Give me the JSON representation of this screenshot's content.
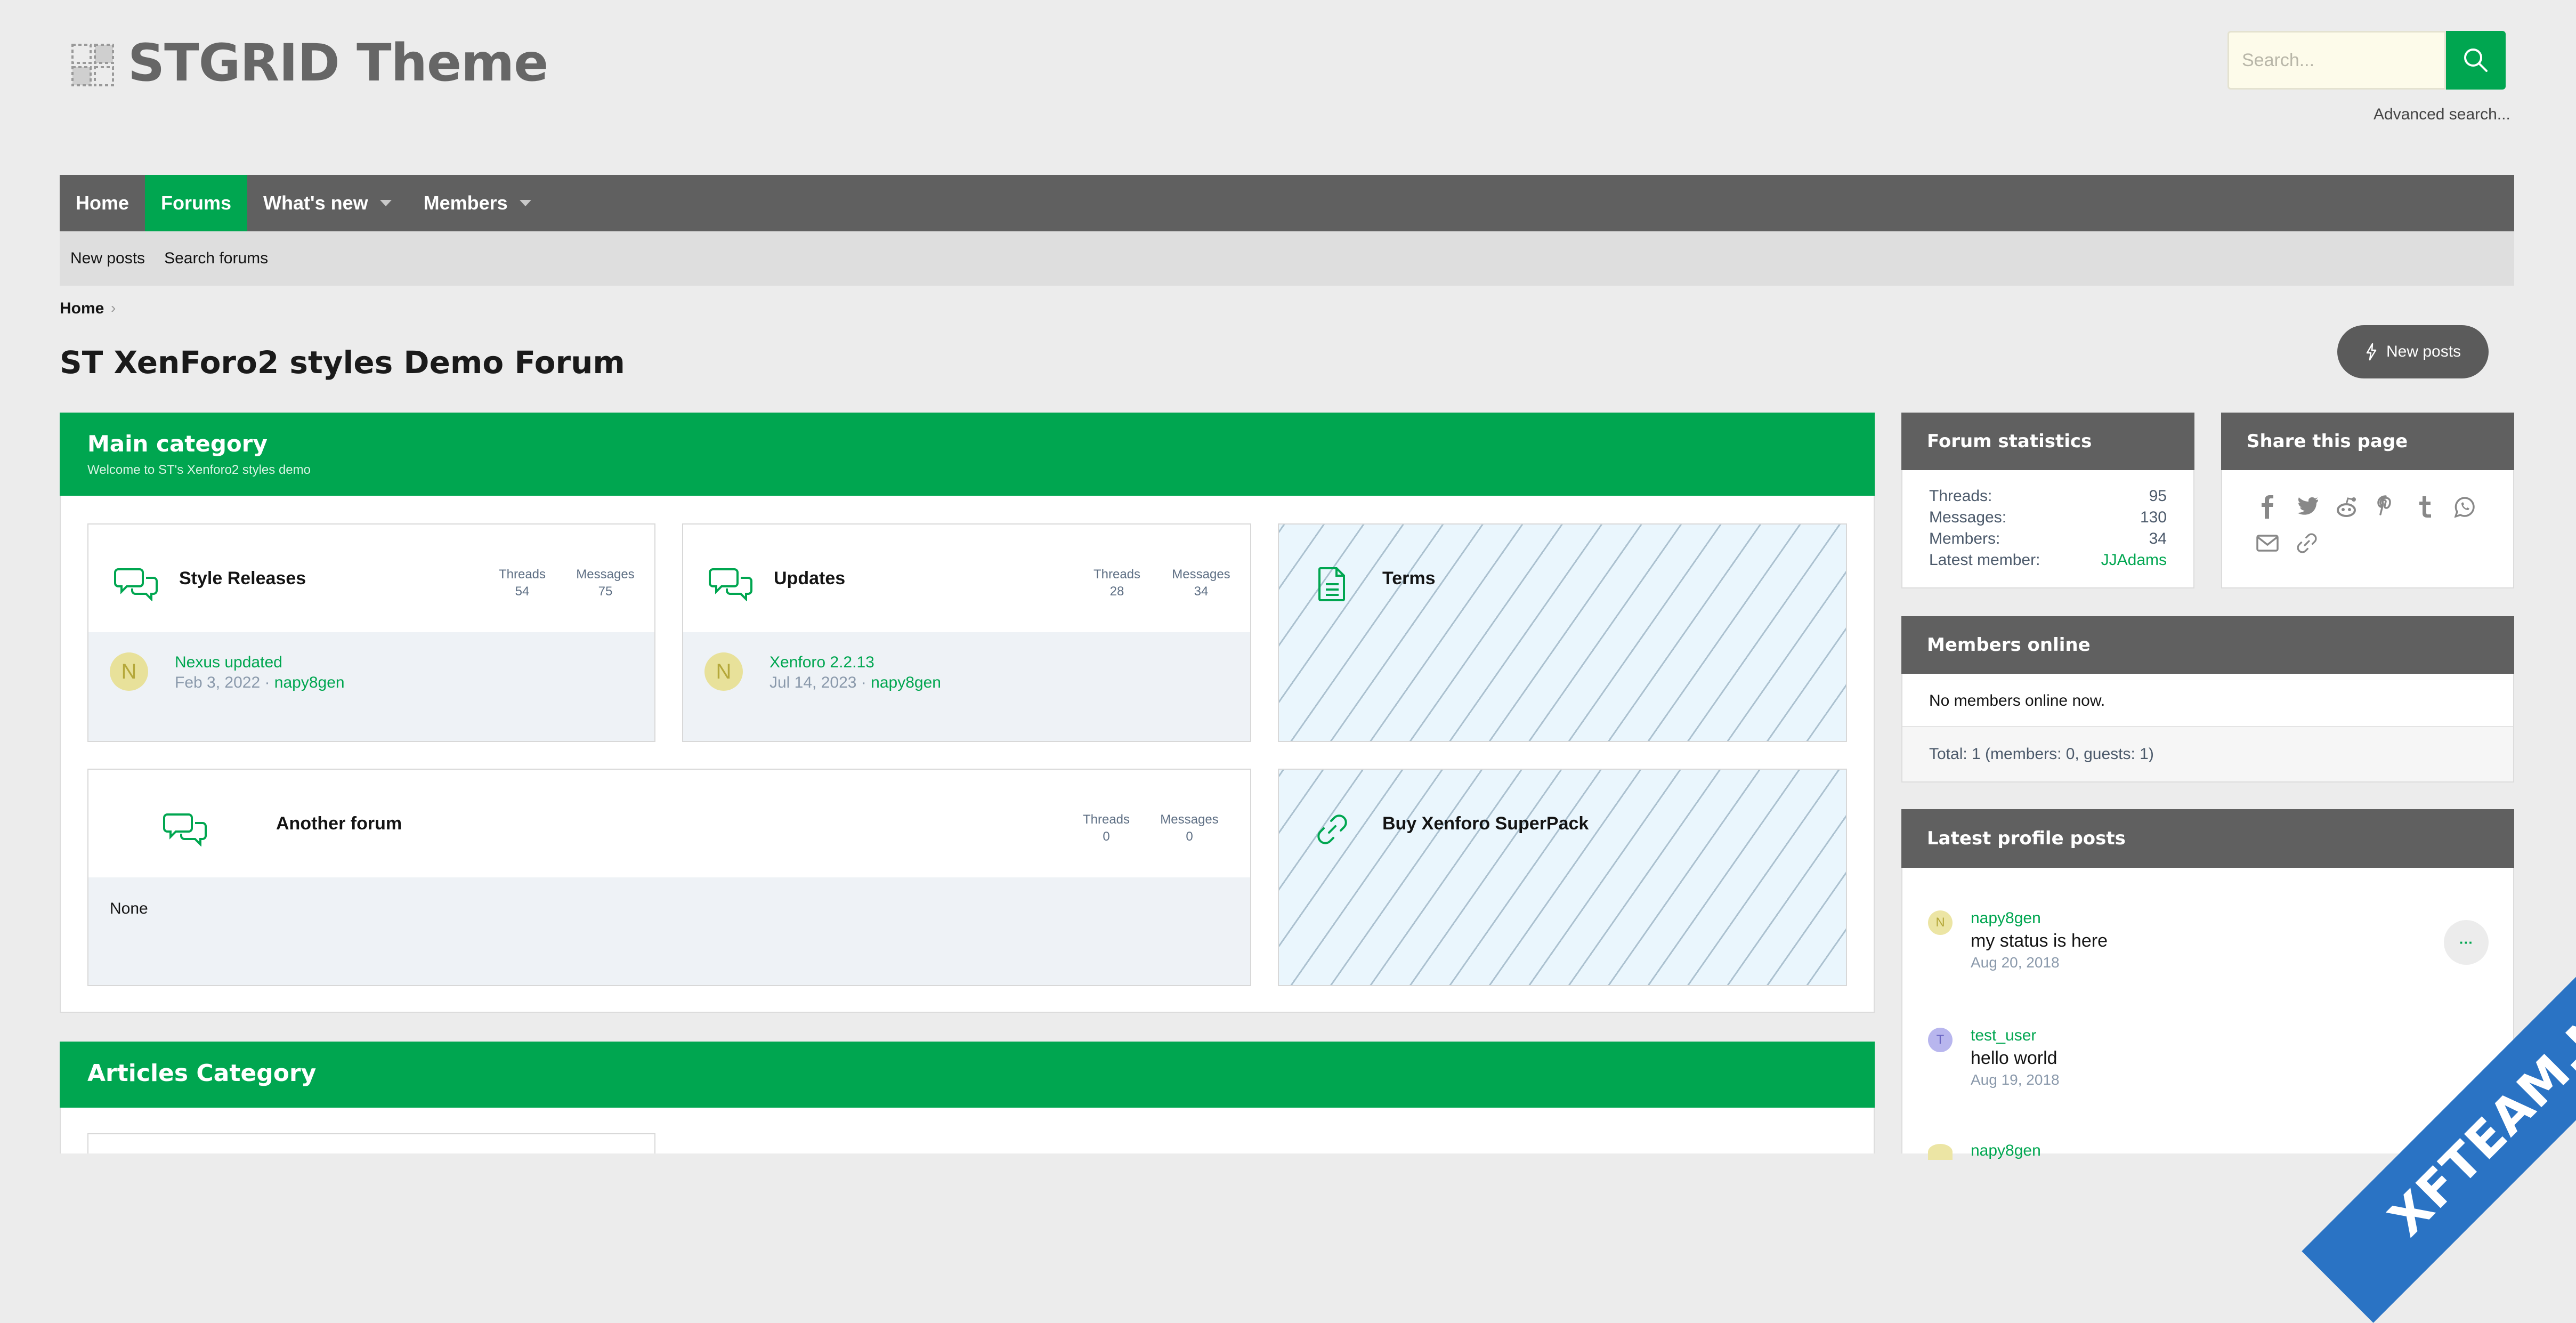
{
  "site": {
    "logo_text": "STGRID Theme"
  },
  "search": {
    "placeholder": "Search...",
    "advanced_label": "Advanced search..."
  },
  "nav": {
    "tabs": [
      {
        "label": "Home"
      },
      {
        "label": "Forums",
        "active": true
      },
      {
        "label": "What's new",
        "has_dropdown": true
      },
      {
        "label": "Members",
        "has_dropdown": true
      }
    ],
    "sub_links": [
      "New posts",
      "Search forums"
    ]
  },
  "breadcrumb": {
    "home": "Home"
  },
  "page": {
    "title": "ST XenForo2 styles Demo Forum",
    "new_posts_button": "New posts"
  },
  "main_category": {
    "title": "Main category",
    "description": "Welcome to ST's Xenforo2 styles demo",
    "forums": [
      {
        "icon": "chat-bubbles-icon",
        "title": "Style Releases",
        "threads_label": "Threads",
        "threads": "54",
        "messages_label": "Messages",
        "messages": "75",
        "last_post_title": "Nexus updated",
        "last_post_date": "Feb 3, 2022",
        "last_post_user": "napy8gen",
        "avatar_letter": "N"
      },
      {
        "icon": "chat-bubbles-icon",
        "title": "Updates",
        "threads_label": "Threads",
        "threads": "28",
        "messages_label": "Messages",
        "messages": "34",
        "last_post_title": "Xenforo 2.2.13",
        "last_post_date": "Jul 14, 2023",
        "last_post_user": "napy8gen",
        "avatar_letter": "N"
      },
      {
        "icon": "document-icon",
        "title": "Terms"
      },
      {
        "icon": "chat-bubbles-icon",
        "title": "Another forum",
        "threads_label": "Threads",
        "threads": "0",
        "messages_label": "Messages",
        "messages": "0",
        "last_post_text": "None"
      },
      {
        "icon": "link-icon",
        "title": "Buy Xenforo SuperPack"
      }
    ]
  },
  "articles_category": {
    "title": "Articles Category"
  },
  "sidebar": {
    "forum_statistics": {
      "title": "Forum statistics",
      "rows": [
        {
          "label": "Threads:",
          "value": "95"
        },
        {
          "label": "Messages:",
          "value": "130"
        },
        {
          "label": "Members:",
          "value": "34"
        },
        {
          "label": "Latest member:",
          "value": "JJAdams"
        }
      ]
    },
    "share": {
      "title": "Share this page",
      "icons": [
        "facebook-icon",
        "twitter-icon",
        "reddit-icon",
        "pinterest-icon",
        "tumblr-icon",
        "whatsapp-icon",
        "email-icon",
        "link-icon"
      ]
    },
    "members_online": {
      "title": "Members online",
      "text": "No members online now.",
      "total": "Total: 1 (members: 0, guests: 1)"
    },
    "latest_profile_posts": {
      "title": "Latest profile posts",
      "posts": [
        {
          "user": "napy8gen",
          "letter": "N",
          "message": "my status is here",
          "date": "Aug 20, 2018",
          "more": "···"
        },
        {
          "user": "test_user",
          "letter": "T",
          "message": "hello world",
          "date": "Aug 19, 2018"
        },
        {
          "user": "napy8gen"
        }
      ]
    }
  },
  "watermark": {
    "text": "XFTEAM.NET"
  },
  "colors": {
    "accent": "#00a650",
    "nav_bg": "#606060",
    "page_bg": "#ececec",
    "hatched_bg": "#eaf6fd"
  }
}
